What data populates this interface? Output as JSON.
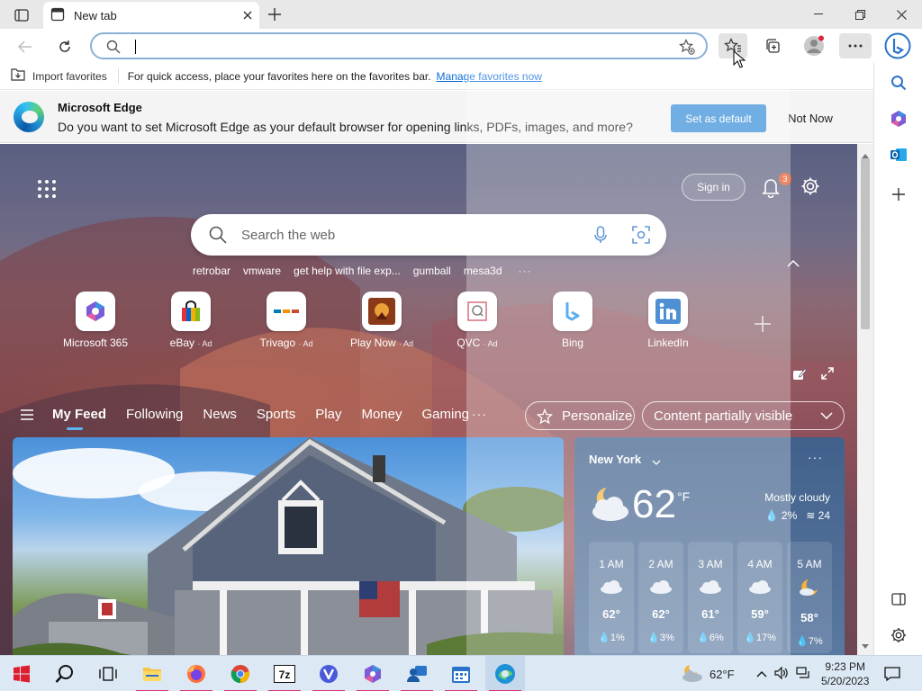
{
  "browser": {
    "tab_title": "New tab",
    "address_value": ""
  },
  "favorites_bar": {
    "import_label": "Import favorites",
    "message": "For quick access, place your favorites here on the favorites bar.",
    "link": "Manage favorites now"
  },
  "infobar": {
    "title": "Microsoft Edge",
    "text": "Do you want to set Microsoft Edge as your default browser for opening links, PDFs, images, and more?",
    "primary_button": "Set as default",
    "secondary_button": "Not Now"
  },
  "newtab": {
    "signin": "Sign in",
    "notification_count": "3",
    "search_placeholder": "Search the web",
    "trending": [
      "retrobar",
      "vmware",
      "get help with file exp...",
      "gumball",
      "mesa3d"
    ],
    "trending_more": "···",
    "quicklinks": [
      {
        "label": "Microsoft 365",
        "ad": ""
      },
      {
        "label": "eBay",
        "ad": "· Ad"
      },
      {
        "label": "Trivago",
        "ad": "· Ad"
      },
      {
        "label": "Play Now",
        "ad": "· Ad"
      },
      {
        "label": "QVC",
        "ad": "· Ad"
      },
      {
        "label": "Bing",
        "ad": ""
      },
      {
        "label": "LinkedIn",
        "ad": ""
      }
    ]
  },
  "feed": {
    "tabs": [
      "My Feed",
      "Following",
      "News",
      "Sports",
      "Play",
      "Money",
      "Gaming"
    ],
    "more": "···",
    "personalize": "Personalize",
    "content_visibility": "Content partially visible"
  },
  "weather": {
    "city": "New York",
    "more": "···",
    "temperature": "62",
    "unit": "°F",
    "condition": "Mostly cloudy",
    "precip": "2%",
    "wind": "24",
    "hourly": [
      {
        "time": "1 AM",
        "temp": "62°",
        "precip": "1%",
        "icon": "cloud-icon"
      },
      {
        "time": "2 AM",
        "temp": "62°",
        "precip": "3%",
        "icon": "cloud-icon"
      },
      {
        "time": "3 AM",
        "temp": "61°",
        "precip": "6%",
        "icon": "cloud-icon"
      },
      {
        "time": "4 AM",
        "temp": "59°",
        "precip": "17%",
        "icon": "cloud-icon"
      },
      {
        "time": "5 AM",
        "temp": "58°",
        "precip": "7%",
        "icon": "moon-cloud-icon"
      }
    ]
  },
  "taskbar": {
    "weather_temp": "62°F",
    "time": "9:23 PM",
    "date": "5/20/2023",
    "apps": [
      "start-icon",
      "search-icon",
      "task-view-icon",
      "file-explorer-icon",
      "firefox-icon",
      "chrome-icon",
      "7zip-icon",
      "vivaldi-icon",
      "copilot-icon",
      "people-icon",
      "calendar-icon",
      "edge-icon"
    ]
  },
  "colors": {
    "accent": "#3a8fd8",
    "link": "#0a6dd8",
    "taskbar": "#dce9f5"
  }
}
